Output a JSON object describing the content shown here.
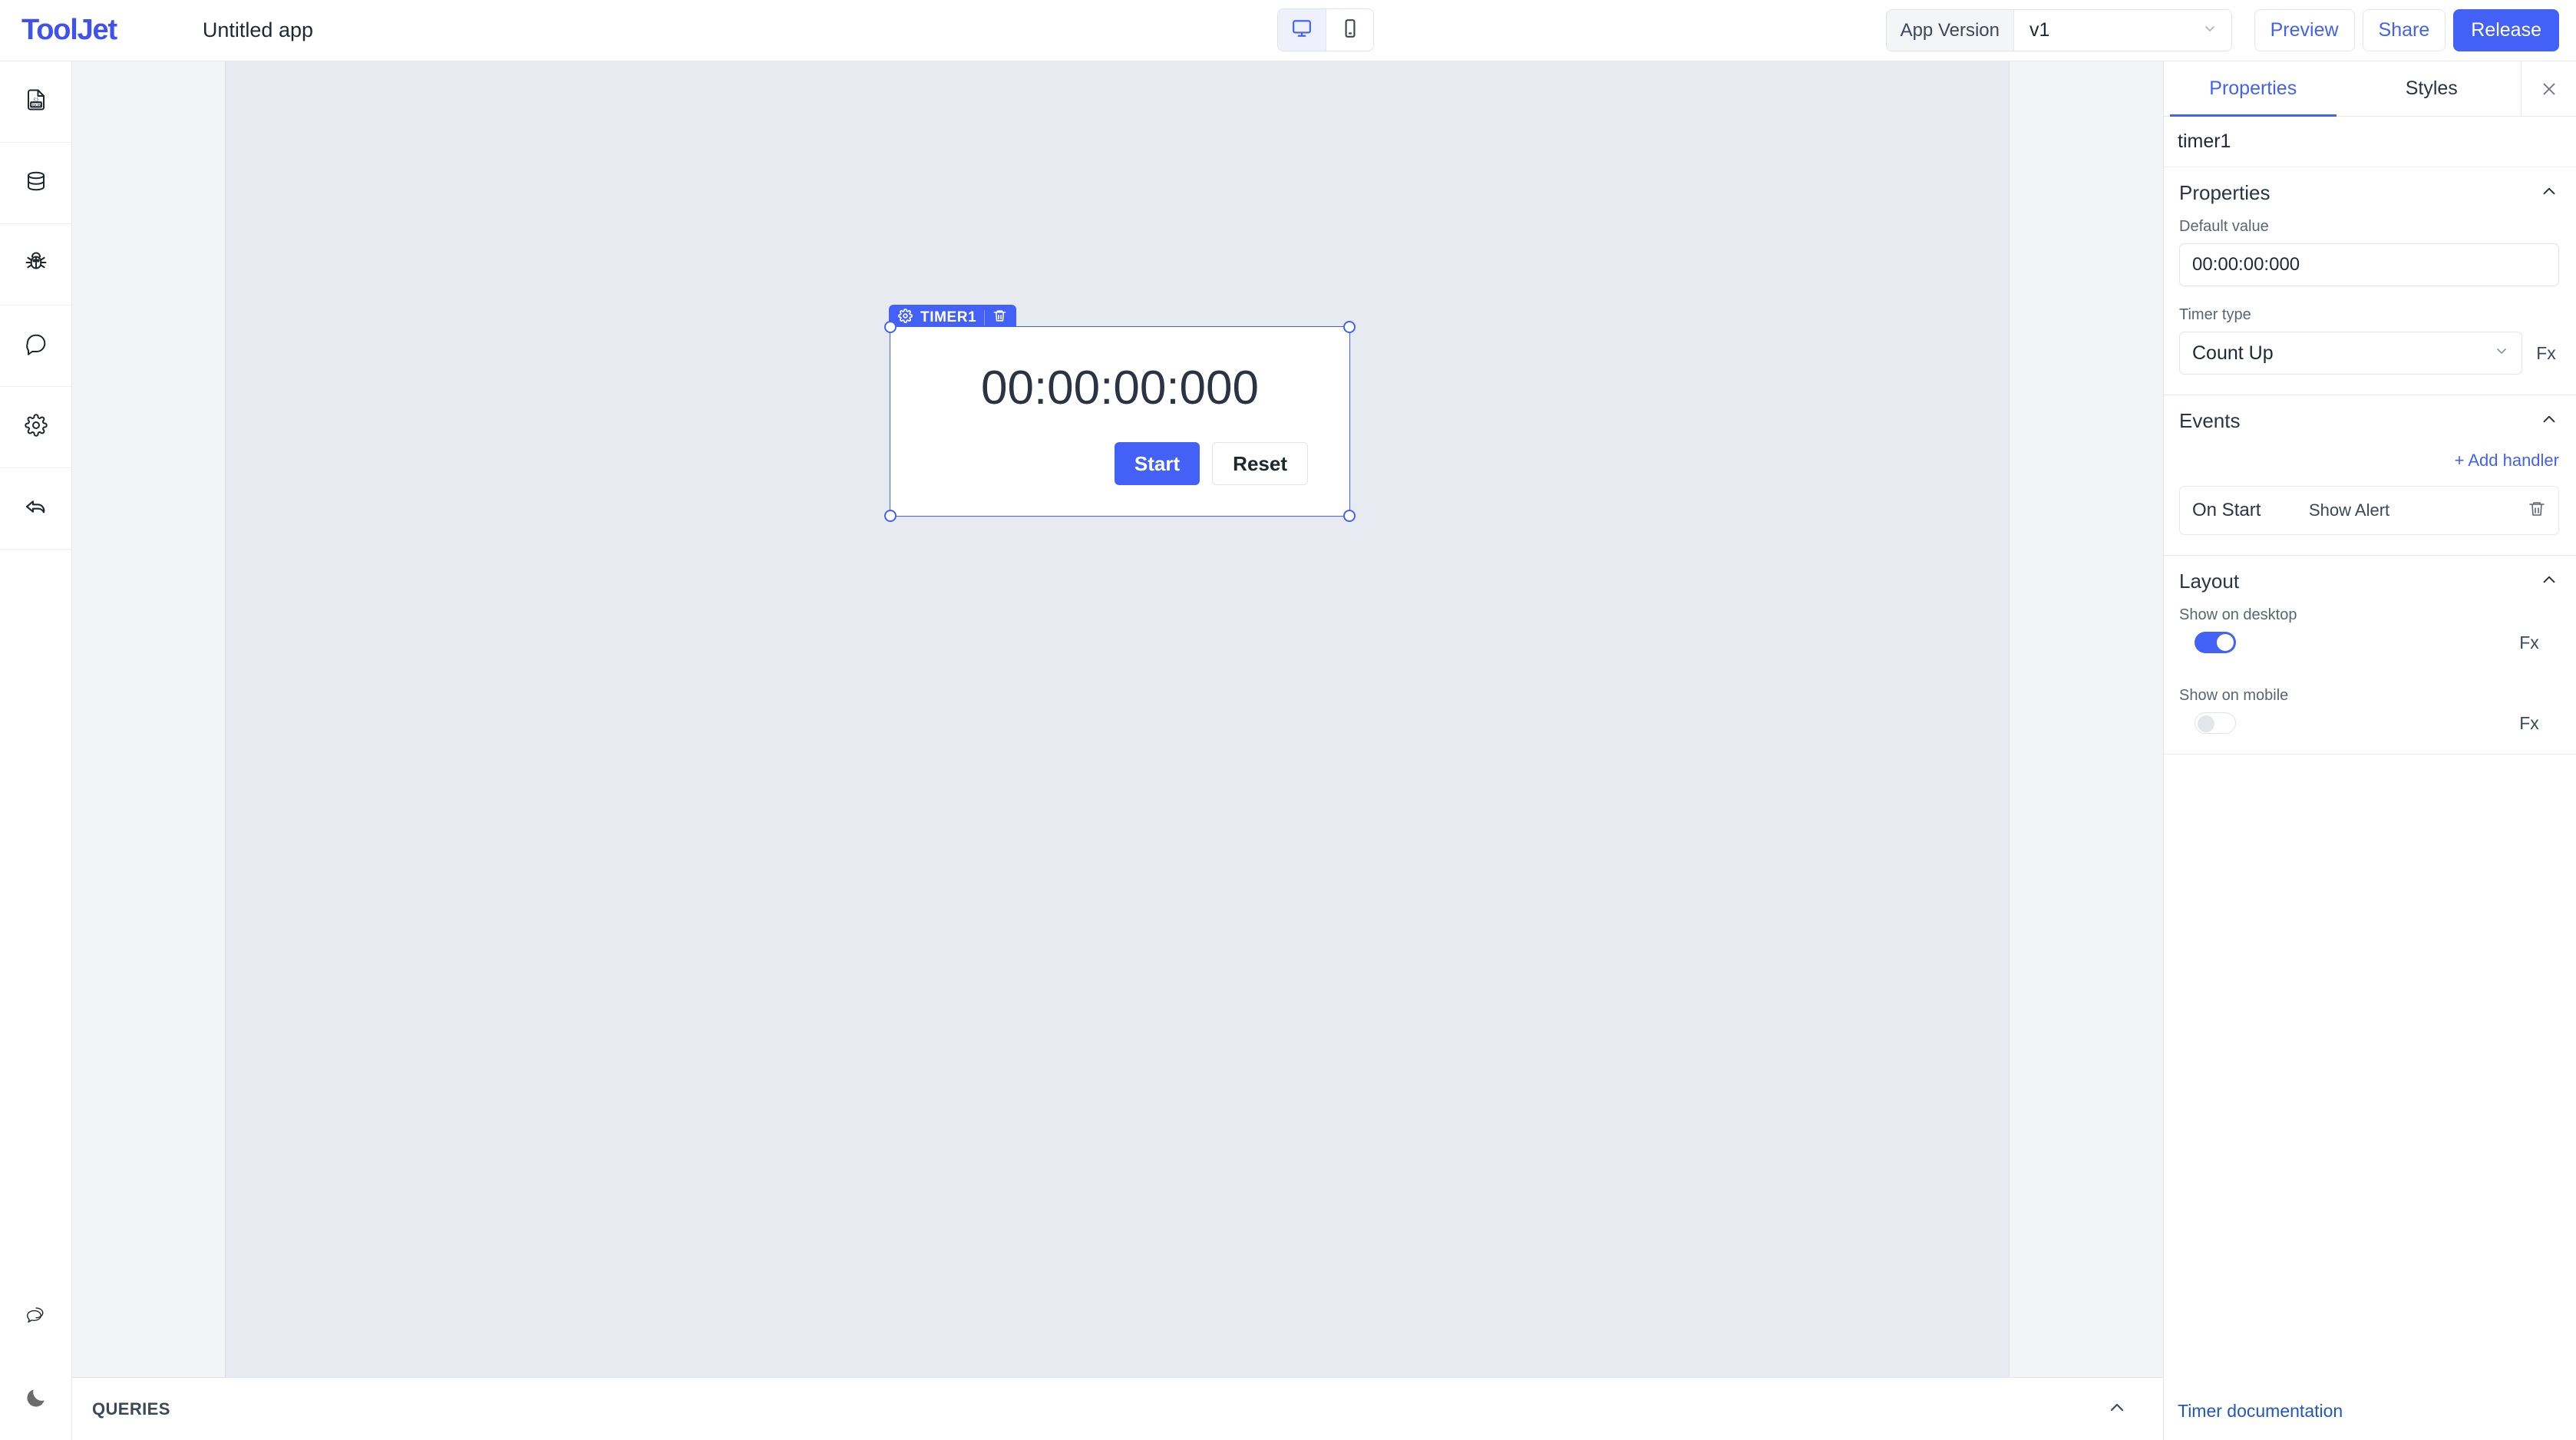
{
  "topbar": {
    "logo": "ToolJet",
    "app_title": "Untitled app",
    "viewport": {
      "desktop_icon": "desktop-monitor-icon",
      "mobile_icon": "mobile-phone-icon",
      "active": "desktop"
    },
    "version_label": "App Version",
    "version_value": "v1",
    "preview_label": "Preview",
    "share_label": "Share",
    "release_label": "Release",
    "accent": "#4361f7"
  },
  "left_rail": {
    "items": [
      {
        "icon": "json-file-icon",
        "name": "page-inspector"
      },
      {
        "icon": "database-icon",
        "name": "data-sources"
      },
      {
        "icon": "bug-icon",
        "name": "debugger"
      },
      {
        "icon": "comment-bubble-icon",
        "name": "comments"
      },
      {
        "icon": "gear-icon",
        "name": "settings"
      },
      {
        "icon": "undo-arrow-icon",
        "name": "left-sidebar-toggle"
      }
    ],
    "bottom_items": [
      {
        "icon": "chat-bubbles-icon",
        "name": "support-chat"
      },
      {
        "icon": "moon-icon",
        "name": "dark-mode-toggle"
      }
    ]
  },
  "canvas": {
    "widget": {
      "badge_name": "TIMER1",
      "badge_gear_icon": "gear-icon",
      "badge_delete_icon": "trash-icon",
      "display_value": "00:00:00:000",
      "start_label": "Start",
      "reset_label": "Reset"
    }
  },
  "queries": {
    "label": "QUERIES",
    "collapse_icon": "chevron-up-icon"
  },
  "panel": {
    "tabs": [
      {
        "label": "Properties",
        "active": true
      },
      {
        "label": "Styles",
        "active": false
      }
    ],
    "close_icon": "close-icon",
    "component_name": "timer1",
    "sections": {
      "properties": {
        "title": "Properties",
        "collapse_icon": "chevron-up-icon",
        "default_value_label": "Default value",
        "default_value": "00:00:00:000",
        "timer_type_label": "Timer type",
        "timer_type_value": "Count Up",
        "fx_label": "Fx"
      },
      "events": {
        "title": "Events",
        "collapse_icon": "chevron-up-icon",
        "add_handler_label": "+ Add handler",
        "handlers": [
          {
            "event": "On Start",
            "action": "Show Alert",
            "delete_icon": "trash-icon"
          }
        ]
      },
      "layout": {
        "title": "Layout",
        "collapse_icon": "chevron-up-icon",
        "show_on_desktop_label": "Show on desktop",
        "show_on_desktop_value": true,
        "show_on_mobile_label": "Show on mobile",
        "show_on_mobile_value": false,
        "fx_label": "Fx"
      }
    },
    "footer_link": "Timer documentation"
  }
}
